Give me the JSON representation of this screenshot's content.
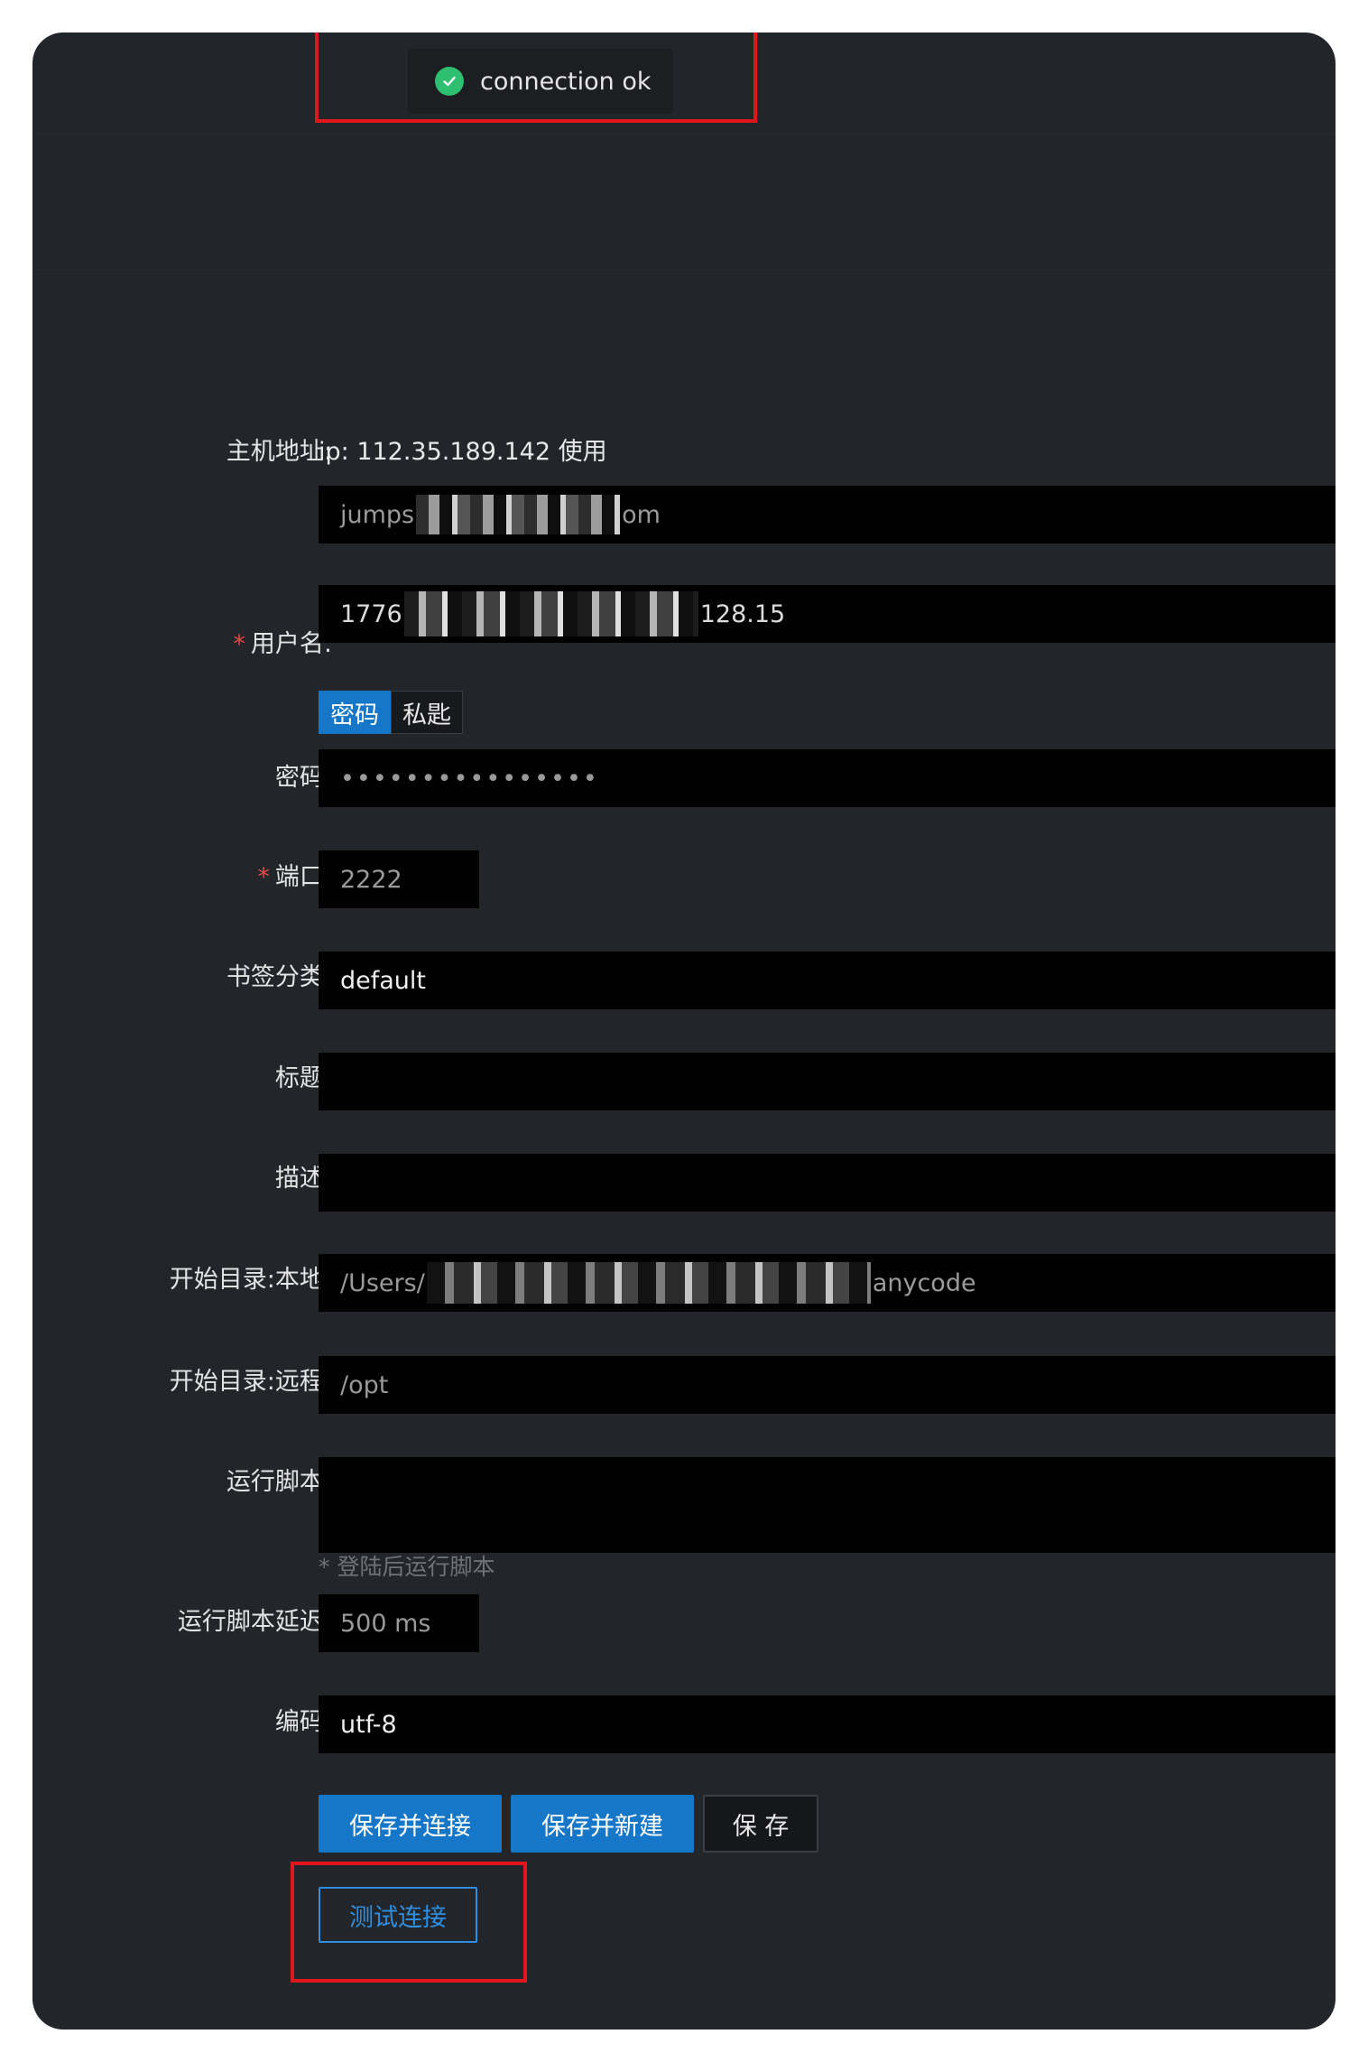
{
  "toast": {
    "message": "connection ok",
    "status": "success"
  },
  "form": {
    "host": {
      "label": "主机地址:",
      "info": "ip: 112.35.189.142 使用",
      "value_start": "jumps",
      "value_end": "om"
    },
    "username": {
      "label": "用户名:",
      "required": "*",
      "value_start": "1776",
      "value_end": "128.15"
    },
    "auth_tabs": [
      {
        "label": "密码",
        "active": true
      },
      {
        "label": "私匙",
        "active": false
      }
    ],
    "password": {
      "label": "密码:",
      "value": "••••••••••••••••"
    },
    "port": {
      "label": "端口:",
      "required": "*",
      "value": "2222"
    },
    "bookmark_category": {
      "label": "书签分类:",
      "value": "default"
    },
    "title": {
      "label": "标题:",
      "value": ""
    },
    "description": {
      "label": "描述:",
      "value": ""
    },
    "start_dir_local": {
      "label": "开始目录:本地:",
      "value_start": "/Users/",
      "value_end": "anycode"
    },
    "start_dir_remote": {
      "label": "开始目录:远程:",
      "value": "/opt"
    },
    "run_script": {
      "label": "运行脚本:",
      "value": "",
      "hint": "* 登陆后运行脚本"
    },
    "run_script_delay": {
      "label": "运行脚本延迟:",
      "value": "500 ms"
    },
    "encoding": {
      "label": "编码:",
      "value": "utf-8"
    }
  },
  "actions": {
    "save_connect": "保存并连接",
    "save_new": "保存并新建",
    "save": "保 存",
    "test_connection": "测试连接"
  },
  "colors": {
    "accent": "#1677c8",
    "success": "#2fbf71",
    "highlight": "#e0161c",
    "background": "#22252a"
  }
}
